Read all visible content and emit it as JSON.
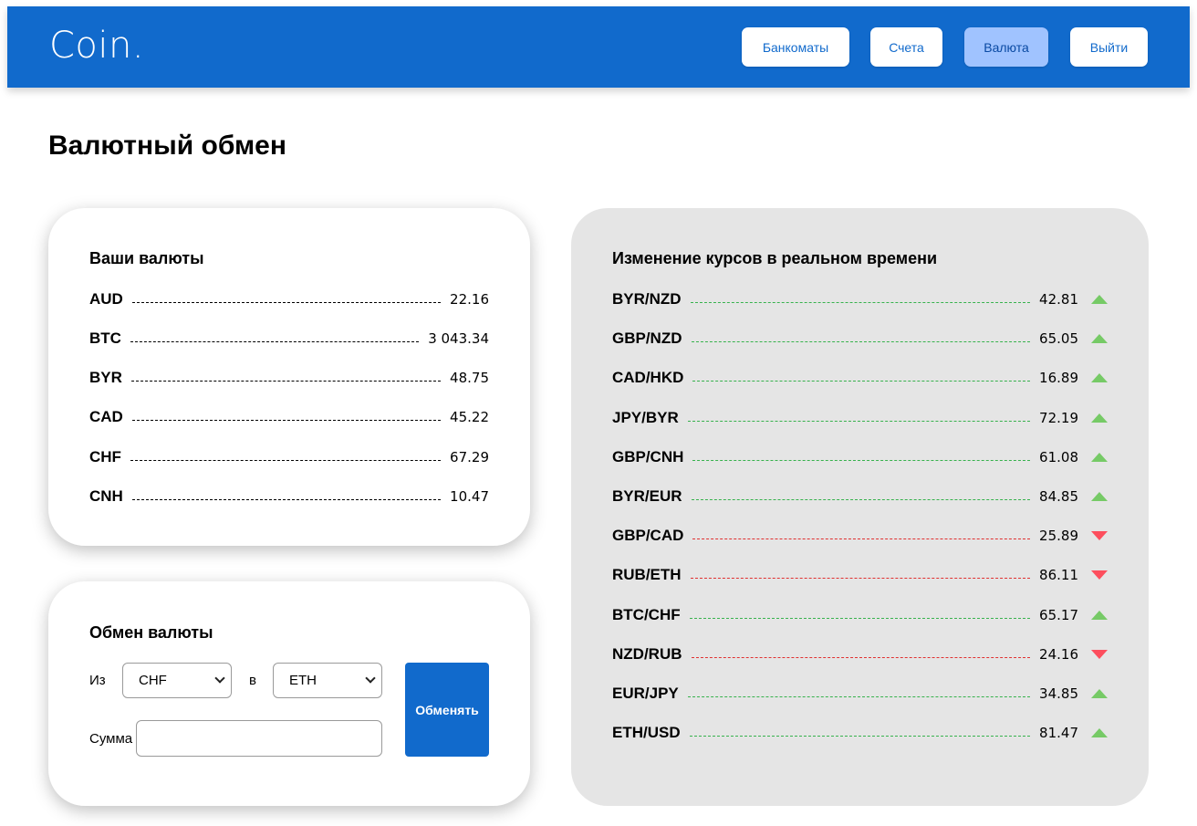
{
  "header": {
    "logo": "Coin.",
    "nav": [
      {
        "label": "Банкоматы",
        "active": false
      },
      {
        "label": "Счета",
        "active": false
      },
      {
        "label": "Валюта",
        "active": true
      },
      {
        "label": "Выйти",
        "active": false
      }
    ]
  },
  "page_title": "Валютный обмен",
  "your_currencies": {
    "title": "Ваши валюты",
    "items": [
      {
        "code": "AUD",
        "value": "22.16"
      },
      {
        "code": "BTC",
        "value": "3 043.34"
      },
      {
        "code": "BYR",
        "value": "48.75"
      },
      {
        "code": "CAD",
        "value": "45.22"
      },
      {
        "code": "CHF",
        "value": "67.29"
      },
      {
        "code": "CNH",
        "value": "10.47"
      }
    ]
  },
  "exchange": {
    "title": "Обмен валюты",
    "from_label": "Из",
    "from_value": "CHF",
    "to_label": "в",
    "to_value": "ETH",
    "amount_label": "Сумма",
    "amount_value": "",
    "button_label": "Обменять"
  },
  "rates": {
    "title": "Изменение курсов в реальном времени",
    "items": [
      {
        "pair": "BYR/NZD",
        "value": "42.81",
        "trend": "up"
      },
      {
        "pair": "GBP/NZD",
        "value": "65.05",
        "trend": "up"
      },
      {
        "pair": "CAD/HKD",
        "value": "16.89",
        "trend": "up"
      },
      {
        "pair": "JPY/BYR",
        "value": "72.19",
        "trend": "up"
      },
      {
        "pair": "GBP/CNH",
        "value": "61.08",
        "trend": "up"
      },
      {
        "pair": "BYR/EUR",
        "value": "84.85",
        "trend": "up"
      },
      {
        "pair": "GBP/CAD",
        "value": "25.89",
        "trend": "down"
      },
      {
        "pair": "RUB/ETH",
        "value": "86.11",
        "trend": "down"
      },
      {
        "pair": "BTC/CHF",
        "value": "65.17",
        "trend": "up"
      },
      {
        "pair": "NZD/RUB",
        "value": "24.16",
        "trend": "down"
      },
      {
        "pair": "EUR/JPY",
        "value": "34.85",
        "trend": "up"
      },
      {
        "pair": "ETH/USD",
        "value": "81.47",
        "trend": "up"
      }
    ]
  },
  "colors": {
    "brand": "#116ACC",
    "active_nav": "#A0C3FF",
    "trend_up": "#76CA66",
    "trend_down": "#FD4E5D",
    "rates_card_bg": "#E5E5E5"
  }
}
